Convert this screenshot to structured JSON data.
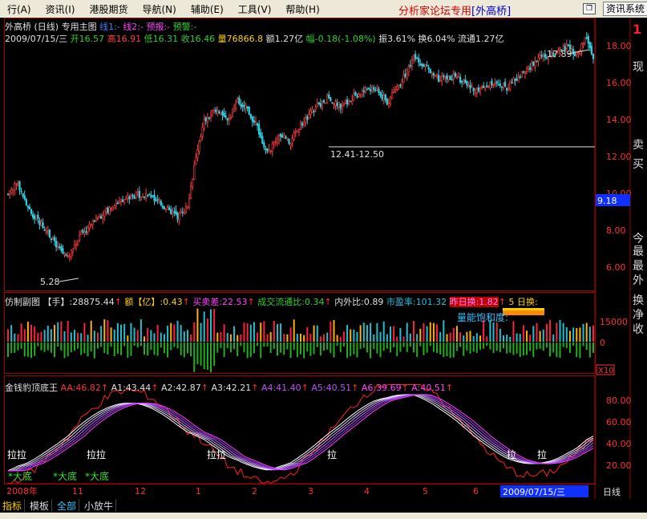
{
  "menu": {
    "items": [
      "行(A)",
      "资讯(I)",
      "港股期货",
      "导航(N)",
      "辅助(E)",
      "工具(V)",
      "帮助(H)"
    ],
    "brand": "分析家论坛专用",
    "brand_stock": "[外高桥]",
    "right_button": "资讯系统"
  },
  "main": {
    "title": "外高桥 (日线) 专用主图",
    "line1": "线1:-",
    "line2": "线2:-",
    "forecast": "预报:-",
    "warning": "预警:-",
    "info": {
      "date": "2009/07/15/三",
      "open": "开16.57",
      "high": "高16.91",
      "low": "低16.31",
      "close": "收16.46",
      "volume": "量76866.8",
      "amount": "额1.27亿",
      "change": "幅-0.18(-1.08%)",
      "amplitude": "振3.61%",
      "turnover": "换6.04%",
      "float": "流通1.27亿"
    },
    "annotations": {
      "high": "17.89",
      "low": "5.28",
      "range": "12.41-12.50",
      "current_price": "9.18"
    },
    "yaxis": [
      "18.00",
      "16.00",
      "14.00",
      "12.00",
      "10.00",
      "8.00",
      "6.00"
    ]
  },
  "right_panel": {
    "marker": "1",
    "chars": [
      "现",
      "卖",
      "买",
      "今",
      "最",
      "最",
      "外",
      "换",
      "净",
      "收"
    ]
  },
  "sub": {
    "title": "仿制副图",
    "hand": "【手】:28875.44",
    "amount": "额【亿】:0.43",
    "bid_ask_diff": "买卖差:22.53",
    "float_ratio": "成交流通比:0.34",
    "in_out": "内外比:0.89",
    "pe": "市盈率:101.32",
    "prev_turnover": "昨日换:1.82",
    "five_day": "5 日换:",
    "saturation": "量能饱和度:",
    "yaxis": [
      "15000",
      "0"
    ],
    "scale": "X10"
  },
  "indicator": {
    "title": "金钱豹顶底王",
    "AA": "AA:46.82",
    "A1": "A1:43.44",
    "A2": "A2:42.87",
    "A3": "A3:42.21",
    "A4": "A4:41.40",
    "A5": "A5:40.51",
    "A6": "A6:39.69",
    "A": "A:40.51",
    "yaxis": [
      "80.00",
      "60.00",
      "40.00",
      "20.00"
    ],
    "labels": {
      "la": "拉",
      "bottom": "*大底",
      "double": "拉拉"
    }
  },
  "xaxis": {
    "year": "2008年",
    "months": [
      "11",
      "12",
      "1",
      "2",
      "3",
      "4",
      "5",
      "6"
    ],
    "current_date": "2009/07/15/三",
    "period": "日线"
  },
  "tabs": [
    "指标",
    "模板",
    "全部",
    "小放牛"
  ],
  "colors": {
    "up": "#ff4040",
    "down": "#30d0e0",
    "grid": "#a00000",
    "accent": "#ffd000"
  }
}
